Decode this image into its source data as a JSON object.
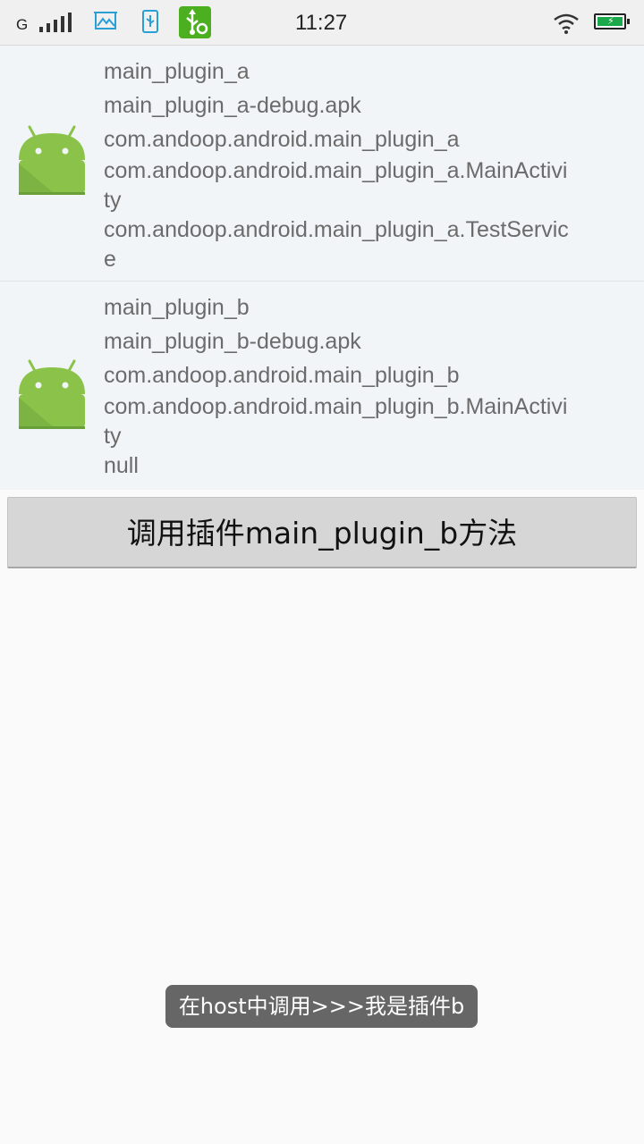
{
  "status_bar": {
    "network": "G",
    "time": "11:27",
    "icons": [
      "signal-icon",
      "image-icon",
      "usb-storage-icon",
      "usb-debug-icon",
      "wifi-icon",
      "battery-charging-icon"
    ]
  },
  "plugins": [
    {
      "name": "main_plugin_a",
      "apk": "main_plugin_a-debug.apk",
      "package": "com.andoop.android.main_plugin_a",
      "activity_line1": "com.andoop.android.main_plugin_a.MainActivi",
      "activity_line2": "ty",
      "service_line1": "com.andoop.android.main_plugin_a.TestServic",
      "service_line2": "e",
      "icon": "android-robot-icon"
    },
    {
      "name": "main_plugin_b",
      "apk": "main_plugin_b-debug.apk",
      "package": "com.andoop.android.main_plugin_b",
      "activity_line1": "com.andoop.android.main_plugin_b.MainActivi",
      "activity_line2": "ty",
      "service": "null",
      "icon": "android-robot-icon"
    }
  ],
  "button": {
    "label": "调用插件main_plugin_b方法"
  },
  "toast": {
    "message": "在host中调用>>>我是插件b"
  },
  "colors": {
    "android_green": "#8bc34a",
    "usb_badge_green": "#4caf1f",
    "battery_green": "#1aa84a",
    "accent_blue": "#2a9fd6"
  }
}
